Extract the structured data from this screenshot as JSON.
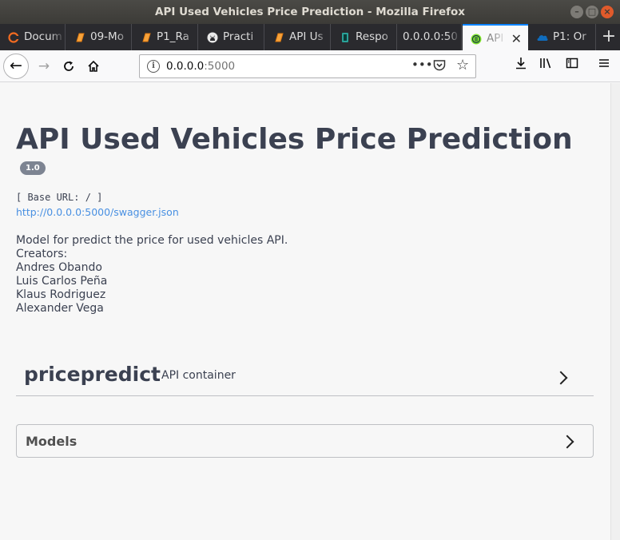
{
  "window": {
    "title": "API Used Vehicles Price Prediction - Mozilla Firefox"
  },
  "tabs": [
    {
      "label": "Docum",
      "icon": "orange-circle-icon"
    },
    {
      "label": "09-Mo",
      "icon": "orange-book-icon"
    },
    {
      "label": "P1_Ra",
      "icon": "orange-book-icon"
    },
    {
      "label": "Practi",
      "icon": "github-icon"
    },
    {
      "label": "API Us",
      "icon": "orange-book-icon"
    },
    {
      "label": "Respo",
      "icon": "teal-document-icon"
    },
    {
      "label": "0.0.0.0:50",
      "icon": ""
    },
    {
      "label": "API",
      "icon": "swagger-icon",
      "active": true
    },
    {
      "label": "P1: Or",
      "icon": "blue-cloud-icon"
    }
  ],
  "navbar": {
    "url_host": "0.0.0.0",
    "url_port": ":5000"
  },
  "page": {
    "title": "API Used Vehicles Price Prediction",
    "version": "1.0",
    "base_url": "[ Base URL: / ]",
    "spec_link": "http://0.0.0.0:5000/swagger.json",
    "description_lines": [
      "Model for predict the price for used vehicles API.",
      "Creators:",
      "Andres Obando",
      "Luis Carlos Peña",
      "Klaus Rodriguez",
      "Alexander Vega"
    ],
    "tag": {
      "name": "pricepredict",
      "description": "API container"
    },
    "models_title": "Models"
  },
  "colors": {
    "text": "#3b4151",
    "link": "#4990e2",
    "badge": "#7d8492",
    "tab_accent": "#0a84ff"
  }
}
